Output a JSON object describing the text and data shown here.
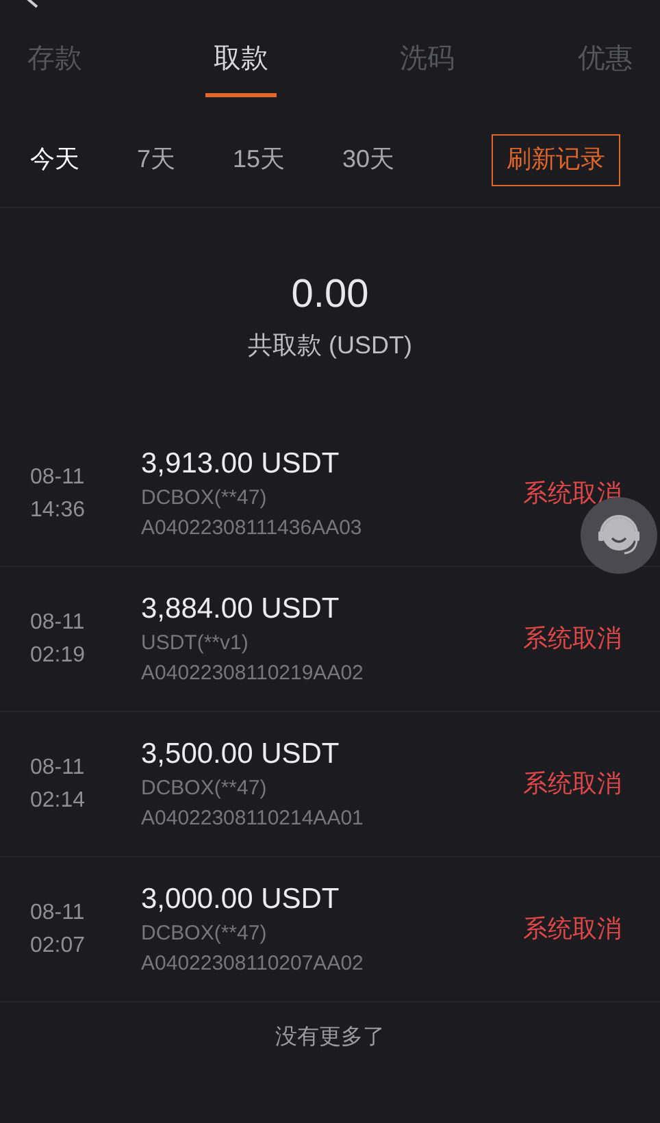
{
  "tabs": [
    {
      "label": "存款",
      "selected": false
    },
    {
      "label": "取款",
      "selected": true
    },
    {
      "label": "洗码",
      "selected": false
    },
    {
      "label": "优惠",
      "selected": false
    }
  ],
  "ranges": [
    {
      "label": "今天",
      "selected": true
    },
    {
      "label": "7天",
      "selected": false
    },
    {
      "label": "15天",
      "selected": false
    },
    {
      "label": "30天",
      "selected": false
    }
  ],
  "refresh_button": "刷新记录",
  "summary": {
    "total": "0.00",
    "label": "共取款 (USDT)"
  },
  "records": [
    {
      "date": "08-11",
      "time": "14:36",
      "amount": "3,913.00 USDT",
      "account": "DCBOX(**47)",
      "order_no": "A04022308111436AA03",
      "status": "系统取消"
    },
    {
      "date": "08-11",
      "time": "02:19",
      "amount": "3,884.00 USDT",
      "account": "USDT(**v1)",
      "order_no": "A04022308110219AA02",
      "status": "系统取消"
    },
    {
      "date": "08-11",
      "time": "02:14",
      "amount": "3,500.00 USDT",
      "account": "DCBOX(**47)",
      "order_no": "A04022308110214AA01",
      "status": "系统取消"
    },
    {
      "date": "08-11",
      "time": "02:07",
      "amount": "3,000.00 USDT",
      "account": "DCBOX(**47)",
      "order_no": "A04022308110207AA02",
      "status": "系统取消"
    }
  ],
  "footer": "没有更多了"
}
